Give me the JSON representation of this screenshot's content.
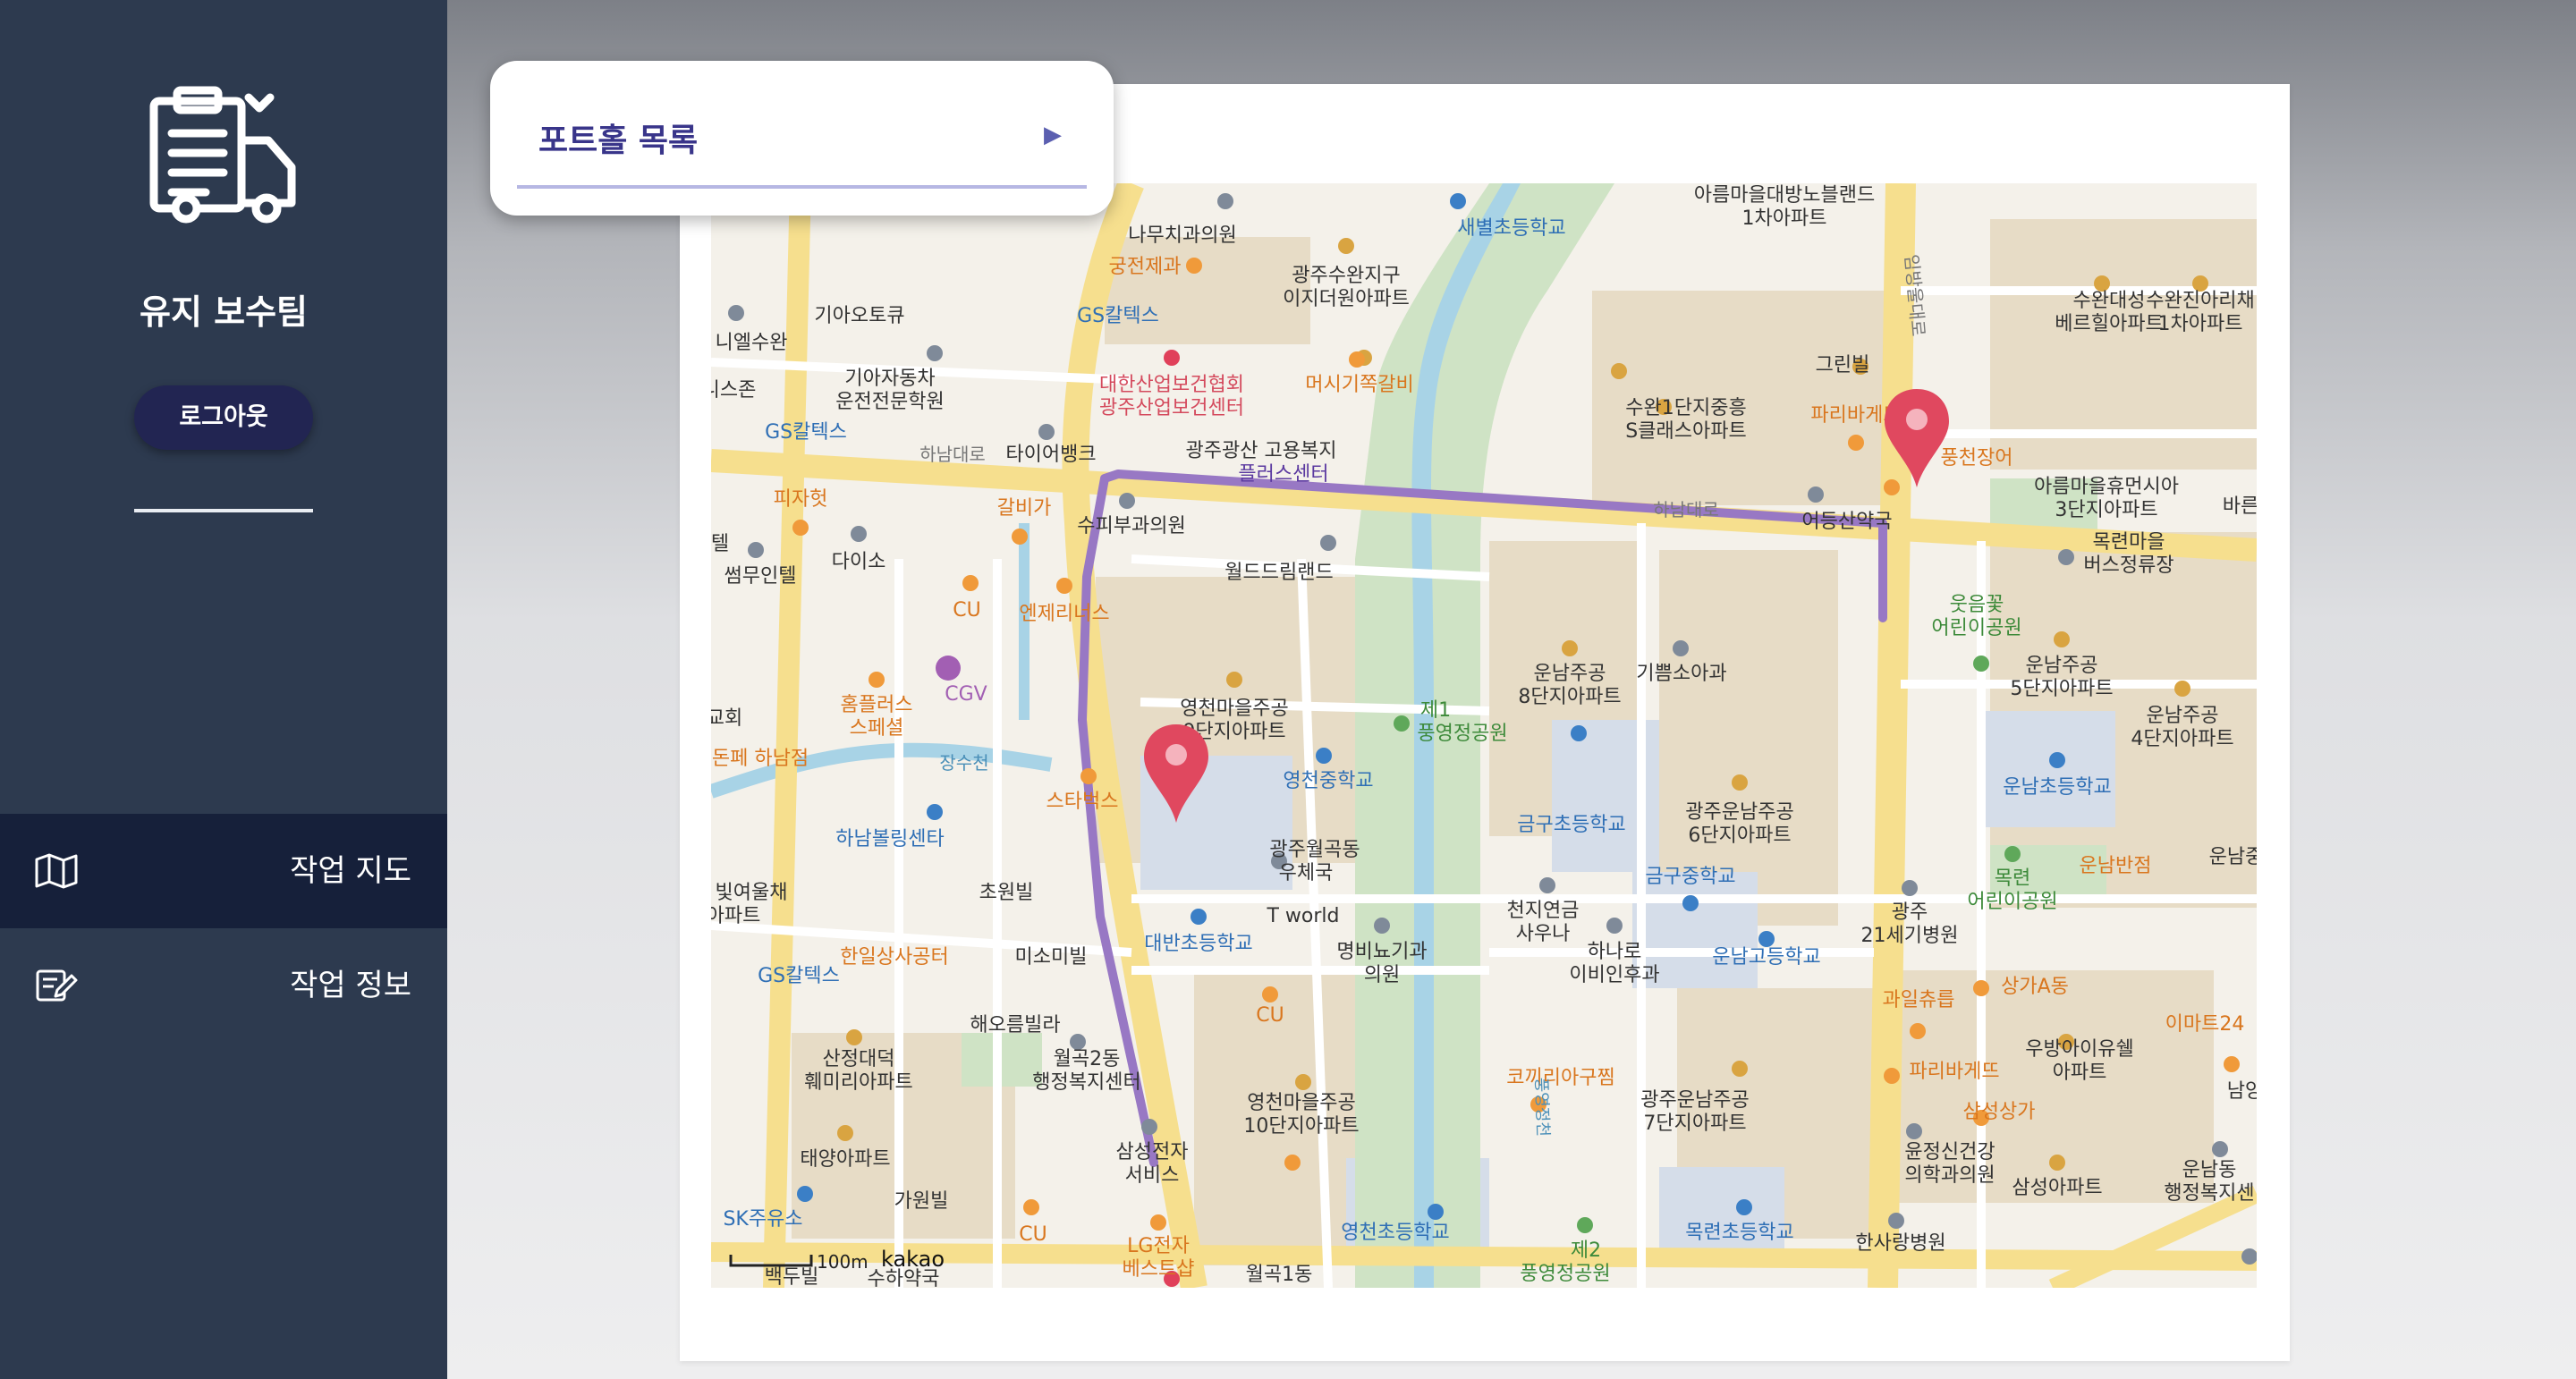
{
  "sidebar": {
    "logo_icon": "maintenance-truck-icon",
    "team_name": "유지 보수팀",
    "logout_label": "로그아웃",
    "nav": [
      {
        "label": "작업 지도",
        "icon": "map-icon",
        "active": true
      },
      {
        "label": "작업 정보",
        "icon": "edit-note-icon",
        "active": false
      }
    ]
  },
  "portal": {
    "title": "포트홀 목록",
    "arrow": "▶"
  },
  "map": {
    "scale_label": "100m",
    "provider": "kakao",
    "markers": [
      "pin-marker-west",
      "pin-marker-east"
    ],
    "route_color": "#9878c4",
    "labels": {
      "l1": "나무치과의원",
      "l2": "새별초등학교",
      "l3": "아름마을대방노블랜드",
      "l3b": "1차아파트",
      "l4": "궁전제과",
      "l5": "광주수완지구",
      "l5b": "이지더원아파트",
      "l6": "수완대성",
      "l6b": "베르힐아파트",
      "l7": "수완진아리채",
      "l7b": "1차아파트",
      "l8": "기아오토큐",
      "l9": "GS칼텍스",
      "l10": "니엘수완",
      "l11": "기아자동차",
      "l11b": "운전전문학원",
      "l12": "대한산업보건협회",
      "l12b": "광주산업보건센터",
      "l13": "머시기쪽갈비",
      "l14": "그린빌",
      "l15": "수완1단지중흥",
      "l15b": "S클래스아파트",
      "l16": "니스존",
      "l17": "GS칼텍스",
      "l18": "하남대로",
      "l19": "타이어뱅크",
      "l20": "광주광산 고용복지",
      "l20b": "플러스센터",
      "l21": "파리바게뜨",
      "l22": "풍천장어",
      "l23": "아름마을휴먼시아",
      "l23b": "3단지아파트",
      "l24": "피자헛",
      "l25": "갈비가",
      "l26": "수피부과의원",
      "l27": "하남대로",
      "l28": "어등산약국",
      "l29": "바른",
      "l30": "다이소",
      "l31": "썸무인텔",
      "l32": "월드드림랜드",
      "l33": "목련마을",
      "l33b": "버스정류장",
      "l34": "CU",
      "l35": "엔제리너스",
      "l36": "웃음꽃",
      "l36b": "어린이공원",
      "l37": "운남주공",
      "l37b": "8단지아파트",
      "l38": "기쁨소아과",
      "l39": "운남주공",
      "l39b": "5단지아파트",
      "l40": "운남주공",
      "l40b": "4단지아파트",
      "l41": "홈플러스",
      "l41b": "스페셜",
      "l42": "CGV",
      "l43": "영천마을주공",
      "l43b": "9단지아파트",
      "l44": "제1",
      "l44b": "풍영정공원",
      "l45": "돈페 하남점",
      "l46": "장수천",
      "l47": "스타벅스",
      "l48": "영천중학교",
      "l49": "운남초등학교",
      "l50": "하남볼링센타",
      "l51": "금구초등학교",
      "l52": "광주운남주공",
      "l52b": "6단지아파트",
      "l53": "운남반점",
      "l54": "광주월곡동",
      "l54b": "우체국",
      "l55": "금구중학교",
      "l56": "목련",
      "l56b": "어린이공원",
      "l57": "빛여울채",
      "l57b": "아파트",
      "l58": "초원빌",
      "l59": "T world",
      "l60": "천지연금",
      "l60b": "사우나",
      "l61": "광주",
      "l61b": "21세기병원",
      "l62": "대반초등학교",
      "l63": "명비뇨기과",
      "l63b": "의원",
      "l64": "하나로",
      "l64b": "이비인후과",
      "l65": "운남고등학교",
      "l66": "한일상사공터",
      "l67": "미소미빌",
      "l68": "GS칼텍스",
      "l69": "과일츄릅",
      "l70": "상가A동",
      "l71": "이마트24",
      "l72": "해오름빌라",
      "l73": "CU",
      "l74": "우방아이유쉘",
      "l74b": "아파트",
      "l75": "산정대덕",
      "l75b": "훼미리아파트",
      "l76": "월곡2동",
      "l76b": "행정복지센터",
      "l77": "코끼리아구찜",
      "l78": "파리바게뜨",
      "l79": "남양",
      "l80": "영천마을주공",
      "l80b": "10단지아파트",
      "l81": "광주운남주공",
      "l81b": "7단지아파트",
      "l82": "삼성상가",
      "l83": "태양아파트",
      "l84": "삼성전자",
      "l84b": "서비스",
      "l85": "윤정신건강",
      "l85b": "의학과의원",
      "l86": "운남동",
      "l86b": "행정복지센",
      "l87": "가원빌",
      "l88": "삼성아파트",
      "l89": "SK주유소",
      "l90": "CU",
      "l91": "영천초등학교",
      "l92": "목련초등학교",
      "l93": "한사랑병원",
      "l94": "LG전자",
      "l94b": "베스트샵",
      "l95": "제2",
      "l95b": "풍영정공원",
      "l96": "월곡1동",
      "l97": "백두빌",
      "l98": "수하약국",
      "l99": "임방울대로",
      "l100": "풍영정천",
      "l101": "운남중",
      "l102": "교회",
      "l103": "텔"
    }
  }
}
